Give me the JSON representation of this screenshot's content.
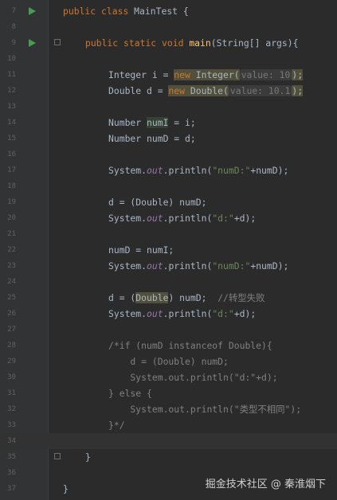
{
  "line_numbers": [
    "7",
    "8",
    "9",
    "10",
    "11",
    "12",
    "13",
    "14",
    "15",
    "16",
    "17",
    "18",
    "19",
    "20",
    "21",
    "22",
    "23",
    "24",
    "25",
    "26",
    "27",
    "28",
    "29",
    "30",
    "31",
    "32",
    "33",
    "34",
    "35",
    "36",
    "37"
  ],
  "code": {
    "l7": {
      "kw1": "public",
      "kw2": "class",
      "name": "MainTest",
      "rest": " {"
    },
    "l9": {
      "kw1": "public",
      "kw2": "static",
      "kw3": "void",
      "fn": "main",
      "rest": "(String[] args){"
    },
    "l11": {
      "a": "Integer i = ",
      "new": "new",
      "b": " Integer(",
      "hint_label": "value:",
      "hint_value": "10",
      "c": ");"
    },
    "l12": {
      "a": "Double d = ",
      "new": "new",
      "b": " Double(",
      "hint_label": "value:",
      "hint_value": "10.1",
      "c": ");"
    },
    "l14": {
      "a": "Number ",
      "var": "numI",
      "b": " = i;"
    },
    "l15": {
      "a": "Number numD = d;"
    },
    "l17": {
      "a": "System.",
      "out": "out",
      "b": ".println(",
      "str": "\"numD:\"",
      "c": "+numD);"
    },
    "l19": {
      "a": "d = (Double) numD;"
    },
    "l20": {
      "a": "System.",
      "out": "out",
      "b": ".println(",
      "str": "\"d:\"",
      "c": "+d);"
    },
    "l22": {
      "a": "numD = numI;"
    },
    "l23": {
      "a": "System.",
      "out": "out",
      "b": ".println(",
      "str": "\"numD:\"",
      "c": "+numD);"
    },
    "l25": {
      "a": "d = (",
      "cast": "Double",
      "b": ") numD;  ",
      "comment": "//转型失败"
    },
    "l26": {
      "a": "System.",
      "out": "out",
      "b": ".println(",
      "str": "\"d:\"",
      "c": "+d);"
    },
    "l28": "/*if (numD instanceof Double){",
    "l29": "    d = (Double) numD;",
    "l30": "    System.out.println(\"d:\"+d);",
    "l31": "} else {",
    "l32": "    System.out.println(\"类型不相同\");",
    "l33": "}*/",
    "l35": "}",
    "l37": "}"
  },
  "watermark": "掘金技术社区 @ 秦淮烟下",
  "colors": {
    "background": "#2b2b2b",
    "keyword": "#cc7832",
    "method": "#ffc66d",
    "field": "#9876aa",
    "string": "#6a8759",
    "number": "#6897bb",
    "comment": "#808080",
    "run_icon": "#499c54"
  },
  "icons": {
    "run": "run-icon",
    "fold": "fold-icon"
  }
}
